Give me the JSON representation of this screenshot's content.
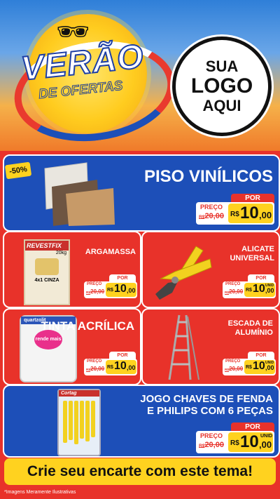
{
  "header": {
    "title_line1": "VERÃO",
    "title_line2": "DE OFERTAS",
    "logo_line1": "SUA",
    "logo_line2": "LOGO",
    "logo_line3": "AQUI"
  },
  "products": [
    {
      "name": "PISO VINÍLICOS",
      "discount": "-50%",
      "por": "POR",
      "preco_label": "PREÇO",
      "old_prefix": "R$",
      "old_price": "20,00",
      "currency": "R$",
      "price_int": "10",
      "price_dec": ",00",
      "unit": ""
    },
    {
      "name": "ARGAMASSA",
      "brand": "REVESTFIX",
      "sub": "20kg",
      "variant": "4x1 CINZA",
      "por": "POR",
      "preco_label": "PREÇO",
      "old_prefix": "R$",
      "old_price": "20,00",
      "currency": "R$",
      "price_int": "10",
      "price_dec": ",00",
      "unit": ""
    },
    {
      "name": "ALICATE UNIVERSAL",
      "por": "POR",
      "preco_label": "PREÇO",
      "old_prefix": "R$",
      "old_price": "20,00",
      "currency": "R$",
      "price_int": "10",
      "price_dec": ",00",
      "unit": "UNID"
    },
    {
      "name": "TINTA ACRÍLICA",
      "brand": "quartzolit",
      "sub": "rende mais",
      "por": "POR",
      "preco_label": "PREÇO",
      "old_prefix": "R$",
      "old_price": "20,00",
      "currency": "R$",
      "price_int": "10",
      "price_dec": ",00",
      "unit": ""
    },
    {
      "name": "ESCADA DE ALUMÍNIO",
      "por": "POR",
      "preco_label": "PREÇO",
      "old_prefix": "R$",
      "old_price": "20,00",
      "currency": "R$",
      "price_int": "10",
      "price_dec": ",00",
      "unit": "UNID"
    },
    {
      "name": "JOGO CHAVES DE FENDA E PHILIPS COM 6 PEÇAS",
      "brand": "Cortag",
      "por": "POR",
      "preco_label": "PREÇO",
      "old_prefix": "R$",
      "old_price": "20,00",
      "currency": "R$",
      "price_int": "10",
      "price_dec": ",00",
      "unit": "UNID"
    }
  ],
  "footer": {
    "cta": "Crie seu encarte com este tema!",
    "note": "*Imagens Meramente Ilustrativas"
  },
  "colors": {
    "blue": "#1d4fb8",
    "red": "#e8322a",
    "yellow": "#ffd21f"
  }
}
